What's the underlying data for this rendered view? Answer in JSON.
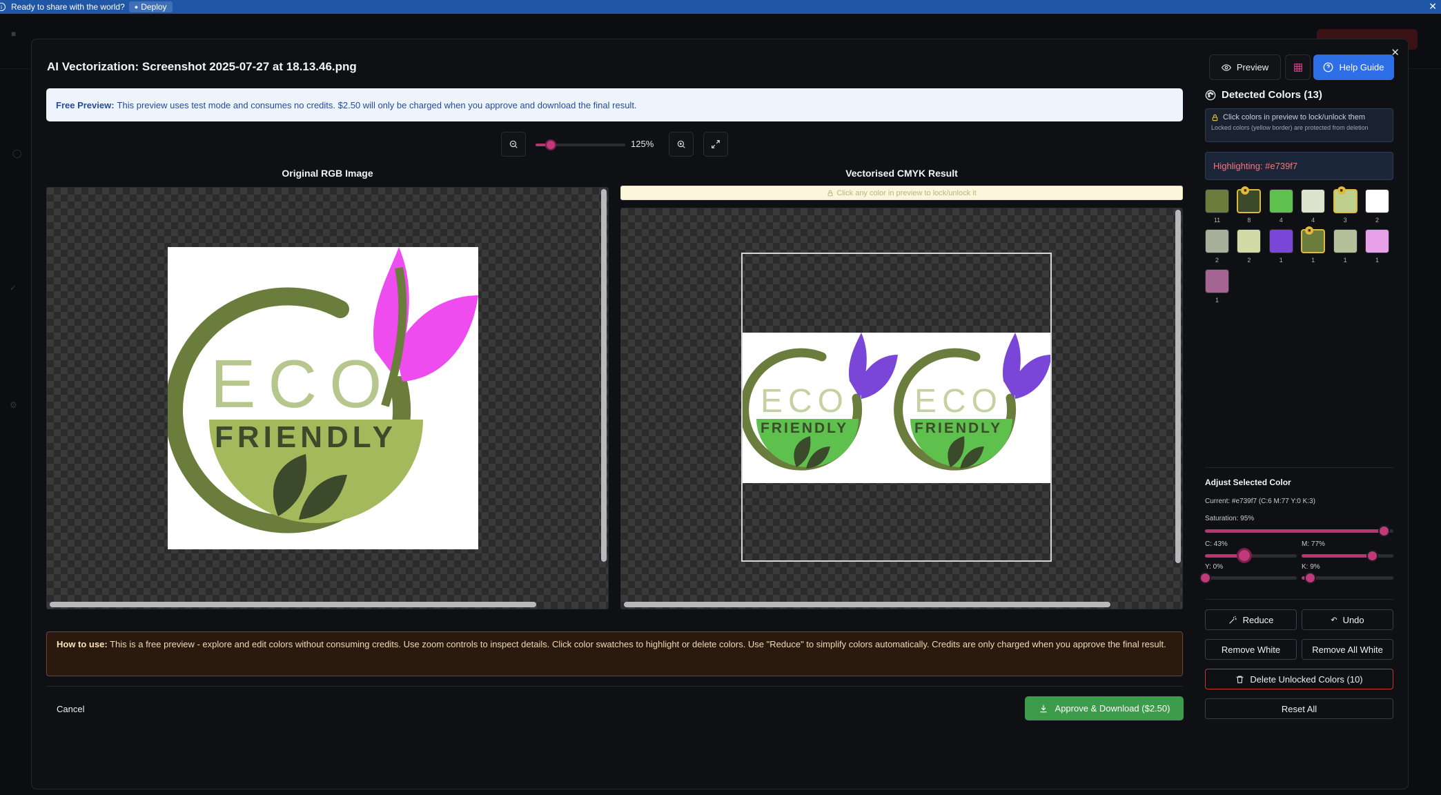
{
  "topbar": {
    "message": "Ready to share with the world?",
    "deploy_label": "Deploy"
  },
  "modal": {
    "title": "AI Vectorization: Screenshot 2025-07-27 at 18.13.46.png",
    "preview_label": "Preview",
    "help_label": "Help Guide"
  },
  "free_preview": {
    "label": "Free Preview:",
    "text": "This preview uses test mode and consumes no credits. $2.50 will only be charged when you approve and download the final result."
  },
  "zoom": {
    "level_label": "125%",
    "level": 125
  },
  "panes": {
    "original_title": "Original RGB Image",
    "result_title": "Vectorised CMYK Result",
    "lock_hint": "Click any color in preview to lock/unlock it"
  },
  "logo": {
    "word1": "ECO",
    "word2": "FRIENDLY"
  },
  "sidebar": {
    "title": "Detected Colors (13)",
    "info_line1": "Click colors in preview to lock/unlock them",
    "info_line2": "Locked colors (yellow border) are protected from deletion",
    "highlighting": "Highlighting: #e739f7",
    "swatches": [
      {
        "color": "#6b7d3c",
        "count": "11",
        "locked": false
      },
      {
        "color": "#3c4a2c",
        "count": "8",
        "locked": true
      },
      {
        "color": "#5fc14d",
        "count": "4",
        "locked": false
      },
      {
        "color": "#dde3cc",
        "count": "4",
        "locked": false
      },
      {
        "color": "#bfcf8e",
        "count": "3",
        "locked": true
      },
      {
        "color": "#ffffff",
        "count": "2",
        "locked": false
      },
      {
        "color": "#a7b09a",
        "count": "2",
        "locked": false
      },
      {
        "color": "#d2dba5",
        "count": "2",
        "locked": false
      },
      {
        "color": "#7a46d8",
        "count": "1",
        "locked": false
      },
      {
        "color": "#6b7d3c",
        "count": "1",
        "locked": true
      },
      {
        "color": "#b3c09a",
        "count": "1",
        "locked": false
      },
      {
        "color": "#e8a1e8",
        "count": "1",
        "locked": false
      },
      {
        "color": "#a56592",
        "count": "1",
        "locked": false
      }
    ],
    "adjust_title": "Adjust Selected Color",
    "current": "Current: #e739f7 (C:6 M:77 Y:0 K:3)",
    "saturation_label": "Saturation: 95%",
    "saturation": 0.95,
    "c_label": "C: 43%",
    "c": 0.43,
    "m_label": "M: 77%",
    "m": 0.77,
    "y_label": "Y: 0%",
    "y": 0.0,
    "k_label": "K: 9%",
    "k": 0.09,
    "reduce_label": "Reduce",
    "undo_label": "Undo",
    "remove_white_label": "Remove White",
    "remove_all_white_label": "Remove All White",
    "delete_unlocked_label": "Delete Unlocked Colors (10)",
    "reset_label": "Reset All"
  },
  "howto": {
    "label": "How to use:",
    "text": "This is a free preview - explore and edit colors without consuming credits. Use zoom controls to inspect details. Click color swatches to highlight or delete colors. Use \"Reduce\" to simplify colors automatically. Credits are only charged when you approve the final result."
  },
  "footer": {
    "cancel_label": "Cancel",
    "approve_label": "Approve & Download ($2.50)"
  },
  "colors": {
    "accent": "#b8356f",
    "help": "#2e6ee6",
    "approve": "#3d9c4b",
    "lock": "#e2b93b"
  }
}
